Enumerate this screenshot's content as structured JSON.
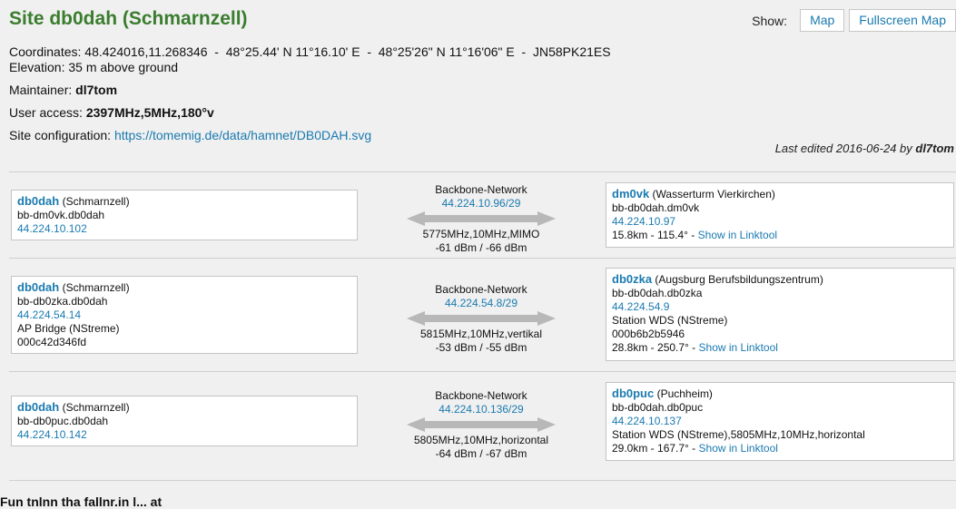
{
  "site": {
    "title": "Site db0dah (Schmarnzell)"
  },
  "header": {
    "show_label": "Show:",
    "map_button": "Map",
    "fullscreen_button": "Fullscreen Map"
  },
  "info": {
    "coords_label": "Coordinates:",
    "coords_value": "48.424016,11.268346  -  48°25.44' N 11°16.10' E  -  48°25'26\" N 11°16'06\" E  -  JN58PK21ES",
    "elevation": "Elevation: 35 m above ground",
    "maintainer_label": "Maintainer:",
    "maintainer_value": "dl7tom",
    "access_label": "User access:",
    "access_value": "2397MHz,5MHz,180°v",
    "config_label": "Site configuration:",
    "config_link": "https://tomemig.de/data/hamnet/DB0DAH.svg",
    "edited_prefix": "Last edited 2016-06-24 by",
    "edited_by": "dl7tom"
  },
  "links": [
    {
      "left": {
        "call": "db0dah",
        "site": "(Schmarnzell)",
        "host": "bb-dm0vk.db0dah",
        "ip": "44.224.10.102",
        "extra1": "",
        "extra2": ""
      },
      "mid": {
        "network": "Backbone-Network",
        "subnet": "44.224.10.96/29",
        "params": "5775MHz,10MHz,MIMO",
        "signal": "-61 dBm / -66 dBm"
      },
      "right": {
        "call": "dm0vk",
        "site": "(Wasserturm Vierkirchen)",
        "host": "bb-db0dah.dm0vk",
        "ip": "44.224.10.97",
        "extra1": "",
        "extra2": "",
        "distance": "15.8km - 115.4° -",
        "linktool": "Show in Linktool"
      }
    },
    {
      "left": {
        "call": "db0dah",
        "site": "(Schmarnzell)",
        "host": "bb-db0zka.db0dah",
        "ip": "44.224.54.14",
        "extra1": "AP Bridge (NStreme)",
        "extra2": "000c42d346fd"
      },
      "mid": {
        "network": "Backbone-Network",
        "subnet": "44.224.54.8/29",
        "params": "5815MHz,10MHz,vertikal",
        "signal": "-53 dBm / -55 dBm"
      },
      "right": {
        "call": "db0zka",
        "site": "(Augsburg Berufsbildungszentrum)",
        "host": "bb-db0dah.db0zka",
        "ip": "44.224.54.9",
        "extra1": "Station WDS (NStreme)",
        "extra2": "000b6b2b5946",
        "distance": "28.8km - 250.7° -",
        "linktool": "Show in Linktool"
      }
    },
    {
      "left": {
        "call": "db0dah",
        "site": "(Schmarnzell)",
        "host": "bb-db0puc.db0dah",
        "ip": "44.224.10.142",
        "extra1": "",
        "extra2": ""
      },
      "mid": {
        "network": "Backbone-Network",
        "subnet": "44.224.10.136/29",
        "params": "5805MHz,10MHz,horizontal",
        "signal": "-64 dBm / -67 dBm"
      },
      "right": {
        "call": "db0puc",
        "site": "(Puchheim)",
        "host": "bb-db0dah.db0puc",
        "ip": "44.224.10.137",
        "extra1": "Station WDS (NStreme),5805MHz,10MHz,horizontal",
        "extra2": "",
        "distance": "29.0km - 167.7° -",
        "linktool": "Show in Linktool"
      }
    }
  ],
  "footer": {
    "text": "Fun tnlnn tha fallnr.in l... at"
  },
  "colors": {
    "title": "#3a7d2e",
    "link": "#1a7ab0",
    "arrow": "#b8b8b8",
    "background": "#f0f0f0"
  }
}
